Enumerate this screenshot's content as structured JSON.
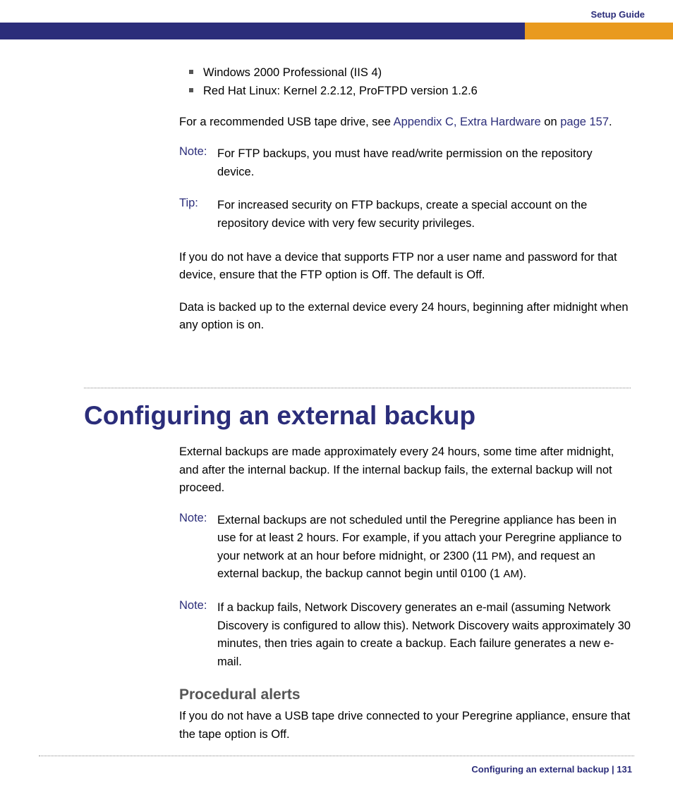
{
  "header": {
    "guide_title": "Setup Guide"
  },
  "bullets": {
    "b1": "Windows 2000 Professional (IIS 4)",
    "b2": "Red Hat Linux: Kernel 2.2.12, ProFTPD version 1.2.6"
  },
  "intro": {
    "pre_link": "For a recommended USB tape drive, see ",
    "link1": "Appendix C, Extra Hardware",
    "mid": " on ",
    "link2": "page 157",
    "post": "."
  },
  "note1": {
    "label": "Note:",
    "body": "For FTP backups, you must have read/write permission on the repository device."
  },
  "tip1": {
    "label": "Tip:",
    "body": "For increased security on FTP backups, create a special account on the repository device with very few security privileges."
  },
  "para2": "If you do not have a device that supports FTP nor a user name and password for that device, ensure that the FTP option is Off. The default is Off.",
  "para3": "Data is backed up to the external device every 24 hours, beginning after midnight when any option is on.",
  "section": {
    "heading": "Configuring an external backup",
    "intro": "External backups are made approximately every 24 hours, some time after midnight, and after the internal backup. If the internal backup fails, the external backup will not proceed.",
    "note2": {
      "label": "Note:",
      "body_pre": "External backups are not scheduled until the Peregrine appliance has been in use for at least 2 hours. For example, if you attach your Peregrine appliance to your network at an hour before midnight, or 2300 (11 ",
      "sc1": "PM",
      "body_mid": "), and request an external backup, the backup cannot begin until 0100 (1 ",
      "sc2": "AM",
      "body_post": ")."
    },
    "note3": {
      "label": "Note:",
      "body": "If a backup fails, Network Discovery generates an e-mail (assuming Network Discovery is configured to allow this). Network Discovery waits approximately 30 minutes, then tries again to create a backup. Each failure generates a new e-mail."
    },
    "subhead": "Procedural alerts",
    "subpara": "If you do not have a USB tape drive connected to your Peregrine appliance, ensure that the tape option is Off."
  },
  "footer": {
    "text": "Configuring an external backup | 131"
  }
}
